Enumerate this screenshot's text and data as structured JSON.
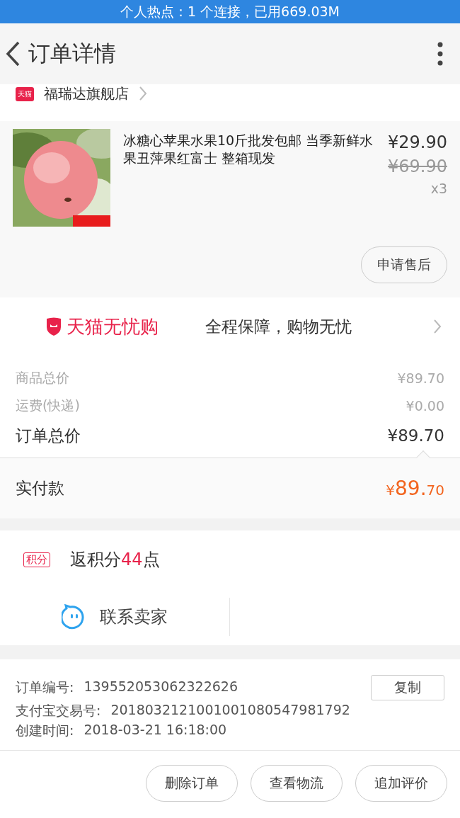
{
  "status_bar": {
    "text": "个人热点：1 个连接，已用669.03M"
  },
  "header": {
    "title": "订单详情"
  },
  "store": {
    "badge": "天猫",
    "name": "福瑞达旗舰店"
  },
  "product": {
    "title": "冰糖心苹果水果10斤批发包邮 当季新鲜水果丑萍果红富士 整箱现发",
    "price": "¥29.90",
    "original_price": "¥69.90",
    "quantity": "x3",
    "action": "申请售后"
  },
  "guarantee": {
    "brand": "天猫无忧购",
    "slogan": "全程保障，购物无忧"
  },
  "summary": [
    {
      "label": "商品总价",
      "value": "¥89.70",
      "kind": "minor"
    },
    {
      "label": "运费(快递)",
      "value": "¥0.00",
      "kind": "minor"
    },
    {
      "label": "订单总价",
      "value": "¥89.70",
      "kind": "major"
    }
  ],
  "paid": {
    "label": "实付款",
    "symbol": "¥",
    "main": "89.",
    "fraction": "70"
  },
  "points": {
    "badge": "积分",
    "prefix": "返积分",
    "amount": "44",
    "suffix": "点"
  },
  "contact": {
    "label": "联系卖家"
  },
  "order_info": [
    {
      "label": "订单编号:",
      "value": "139552053062322626"
    },
    {
      "label": "支付宝交易号:",
      "value": "2018032121001001080547981792"
    },
    {
      "label": "创建时间:",
      "value": "2018-03-21 16:18:00"
    }
  ],
  "copy_button": "复制",
  "actions": [
    "删除订单",
    "查看物流",
    "追加评价"
  ]
}
